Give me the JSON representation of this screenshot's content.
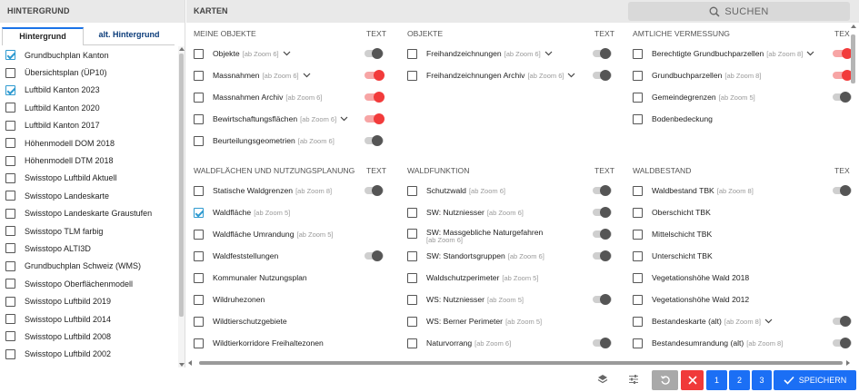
{
  "left": {
    "title": "HINTERGRUND",
    "tabs": [
      "Hintergrund",
      "alt. Hintergrund"
    ],
    "items": [
      {
        "label": "Grundbuchplan Kanton",
        "checked": true
      },
      {
        "label": "Übersichtsplan (ÜP10)",
        "checked": false
      },
      {
        "label": "Luftbild Kanton 2023",
        "checked": true
      },
      {
        "label": "Luftbild Kanton 2020",
        "checked": false
      },
      {
        "label": "Luftbild Kanton 2017",
        "checked": false
      },
      {
        "label": "Höhenmodell DOM 2018",
        "checked": false
      },
      {
        "label": "Höhenmodell DTM 2018",
        "checked": false
      },
      {
        "label": "Swisstopo Luftbild Aktuell",
        "checked": false
      },
      {
        "label": "Swisstopo Landeskarte",
        "checked": false
      },
      {
        "label": "Swisstopo Landeskarte Graustufen",
        "checked": false
      },
      {
        "label": "Swisstopo TLM farbig",
        "checked": false
      },
      {
        "label": "Swisstopo ALTI3D",
        "checked": false
      },
      {
        "label": "Grundbuchplan Schweiz (WMS)",
        "checked": false
      },
      {
        "label": "Swisstopo Oberflächenmodell",
        "checked": false
      },
      {
        "label": "Swisstopo Luftbild 2019",
        "checked": false
      },
      {
        "label": "Swisstopo Luftbild 2014",
        "checked": false
      },
      {
        "label": "Swisstopo Luftbild 2008",
        "checked": false
      },
      {
        "label": "Swisstopo Luftbild 2002",
        "checked": false
      }
    ]
  },
  "right": {
    "title": "KARTEN",
    "search_label": "SUCHEN",
    "text_col": "TEXT",
    "text_col_cut": "TEX",
    "sections": {
      "meine_objekte": {
        "title": "MEINE OBJEKTE",
        "rows": [
          {
            "label": "Objekte",
            "zoom": "[ab Zoom 6]",
            "chevron": true,
            "toggle": "off"
          },
          {
            "label": "Massnahmen",
            "zoom": "[ab Zoom 6]",
            "chevron": true,
            "toggle": "on"
          },
          {
            "label": "Massnahmen Archiv",
            "zoom": "[ab Zoom 6]",
            "chevron": false,
            "toggle": "on"
          },
          {
            "label": "Bewirtschaftungsflächen",
            "zoom": "[ab Zoom 6]",
            "chevron": true,
            "toggle": "on"
          },
          {
            "label": "Beurteilungsgeometrien",
            "zoom": "[ab Zoom 6]",
            "chevron": false,
            "toggle": "off"
          }
        ]
      },
      "objekte": {
        "title": "OBJEKTE",
        "rows": [
          {
            "label": "Freihandzeichnungen",
            "zoom": "[ab Zoom 6]",
            "chevron": true,
            "toggle": "off"
          },
          {
            "label": "Freihandzeichnungen Archiv",
            "zoom": "[ab Zoom 6]",
            "chevron": true,
            "toggle": "off"
          }
        ]
      },
      "amtliche": {
        "title": "AMTLICHE VERMESSUNG",
        "rows": [
          {
            "label": "Berechtigte Grundbuchparzellen",
            "zoom": "[ab Zoom 8]",
            "chevron": true,
            "toggle": "on"
          },
          {
            "label": "Grundbuchparzellen",
            "zoom": "[ab Zoom 8]",
            "chevron": false,
            "toggle": "on"
          },
          {
            "label": "Gemeindegrenzen",
            "zoom": "[ab Zoom 5]",
            "chevron": false,
            "toggle": "off"
          },
          {
            "label": "Bodenbedeckung",
            "zoom": "",
            "chevron": false,
            "toggle": "none"
          }
        ]
      },
      "waldflaechen": {
        "title": "WALDFLÄCHEN UND NUTZUNGSPLANUNG",
        "rows": [
          {
            "label": "Statische Waldgrenzen",
            "zoom": "[ab Zoom 8]",
            "checked": false,
            "toggle": "off"
          },
          {
            "label": "Waldfläche",
            "zoom": "[ab Zoom 5]",
            "checked": true,
            "toggle": "none"
          },
          {
            "label": "Waldfläche Umrandung",
            "zoom": "[ab Zoom 5]",
            "checked": false,
            "toggle": "none"
          },
          {
            "label": "Waldfeststellungen",
            "zoom": "",
            "checked": false,
            "toggle": "off"
          },
          {
            "label": "Kommunaler Nutzungsplan",
            "zoom": "",
            "checked": false,
            "toggle": "none"
          },
          {
            "label": "Wildruhezonen",
            "zoom": "",
            "checked": false,
            "toggle": "none"
          },
          {
            "label": "Wildtierschutzgebiete",
            "zoom": "",
            "checked": false,
            "toggle": "none"
          },
          {
            "label": "Wildtierkorridore Freihaltezonen",
            "zoom": "",
            "checked": false,
            "toggle": "none"
          }
        ]
      },
      "waldfunktion": {
        "title": "WALDFUNKTION",
        "rows": [
          {
            "label": "Schutzwald",
            "zoom": "[ab Zoom 6]",
            "toggle": "off"
          },
          {
            "label": "SW: Nutzniesser",
            "zoom": "[ab Zoom 6]",
            "toggle": "off"
          },
          {
            "label": "SW: Massgebliche Naturgefahren",
            "zoom": "[ab Zoom 6]",
            "toggle": "off",
            "wrap": true
          },
          {
            "label": "SW: Standortsgruppen",
            "zoom": "[ab Zoom 6]",
            "toggle": "off"
          },
          {
            "label": "Waldschutzperimeter",
            "zoom": "[ab Zoom 5]",
            "toggle": "none"
          },
          {
            "label": "WS: Nutzniesser",
            "zoom": "[ab Zoom 5]",
            "toggle": "off"
          },
          {
            "label": "WS: Berner Perimeter",
            "zoom": "[ab Zoom 5]",
            "toggle": "none"
          },
          {
            "label": "Naturvorrang",
            "zoom": "[ab Zoom 6]",
            "toggle": "off"
          }
        ]
      },
      "waldbestand": {
        "title": "WALDBESTAND",
        "rows": [
          {
            "label": "Waldbestand TBK",
            "zoom": "[ab Zoom 8]",
            "chevron": false,
            "toggle": "off"
          },
          {
            "label": "Oberschicht TBK",
            "zoom": "",
            "chevron": false,
            "toggle": "none"
          },
          {
            "label": "Mittelschicht TBK",
            "zoom": "",
            "chevron": false,
            "toggle": "none"
          },
          {
            "label": "Unterschicht TBK",
            "zoom": "",
            "chevron": false,
            "toggle": "none"
          },
          {
            "label": "Vegetationshöhe Wald 2018",
            "zoom": "",
            "chevron": false,
            "toggle": "none"
          },
          {
            "label": "Vegetationshöhe Wald 2012",
            "zoom": "",
            "chevron": false,
            "toggle": "none"
          },
          {
            "label": "Bestandeskarte (alt)",
            "zoom": "[ab Zoom 8]",
            "chevron": true,
            "toggle": "off"
          },
          {
            "label": "Bestandesumrandung (alt)",
            "zoom": "[ab Zoom 8]",
            "chevron": false,
            "toggle": "off"
          }
        ]
      }
    }
  },
  "bottom": {
    "layers_icon": "layers-icon",
    "settings_icon": "sliders-icon",
    "reset_icon": "reset-icon",
    "close_icon": "close-icon",
    "page_buttons": [
      "1",
      "2",
      "3"
    ],
    "save_label": "SPEICHERN"
  },
  "colors": {
    "accent": "#1b6ff5",
    "toggle_on": "#f23b3b",
    "check": "#2e9ad0",
    "danger": "#f03a3a"
  }
}
